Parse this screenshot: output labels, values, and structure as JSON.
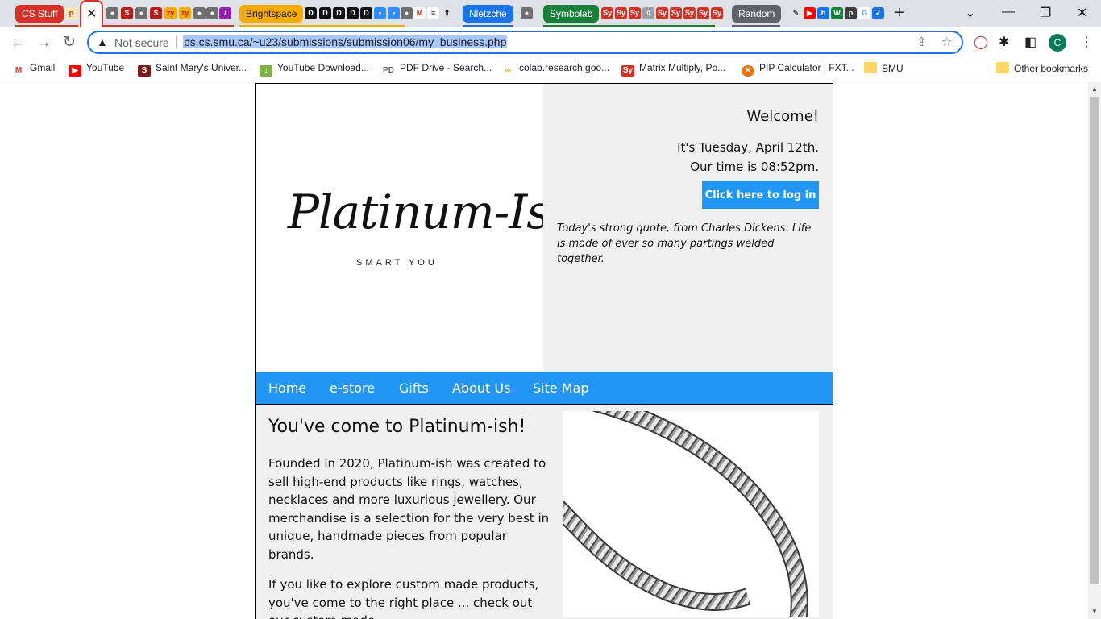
{
  "browser": {
    "tab_groups": [
      {
        "label": "CS Stuff",
        "color": "#d93025"
      },
      {
        "label": "Brightspace",
        "color": "#f9ab00"
      },
      {
        "label": "Nletzche",
        "color": "#1a73e8"
      },
      {
        "label": "Symbolab",
        "color": "#188038"
      },
      {
        "label": "Random",
        "color": "#5f6368"
      }
    ],
    "active_tab_close": "✕",
    "new_tab": "+",
    "omnibox": {
      "security_label": "Not secure",
      "url": "ps.cs.smu.ca/~u23/submissions/submission06/my_business.php"
    },
    "profile_initial": "C",
    "bookmarks": [
      {
        "label": "Gmail"
      },
      {
        "label": "YouTube"
      },
      {
        "label": "Saint Mary's Univer..."
      },
      {
        "label": "YouTube Download..."
      },
      {
        "label": "PDF Drive - Search..."
      },
      {
        "label": "colab.research.goo..."
      },
      {
        "label": "Matrix Multiply, Po..."
      },
      {
        "label": "PIP Calculator | FXT..."
      },
      {
        "label": "SMU"
      }
    ],
    "other_bookmarks": "Other bookmarks"
  },
  "site": {
    "logo": {
      "name": "Platinum-Ish",
      "tagline": "SMART YOU"
    },
    "welcome": "Welcome!",
    "date_line": "It's Tuesday, April 12th.",
    "time_line": "Our time is 08:52pm.",
    "login_label": "Click here to log in",
    "quote": "Today's strong quote, from Charles Dickens: Life is made of ever so many partings welded together.",
    "nav": [
      "Home",
      "e-store",
      "Gifts",
      "About Us",
      "Site Map"
    ],
    "main": {
      "heading": "You've come to Platinum-ish!",
      "para1": "Founded in 2020, Platinum-ish was created to sell high-end products like rings, watches, necklaces and more luxurious jewellery. Our merchandise is a selection for the very best in unique, handmade pieces from popular brands.",
      "para2": "If you like to explore custom made products, you've come to the right place ... check out our custom made..."
    }
  }
}
